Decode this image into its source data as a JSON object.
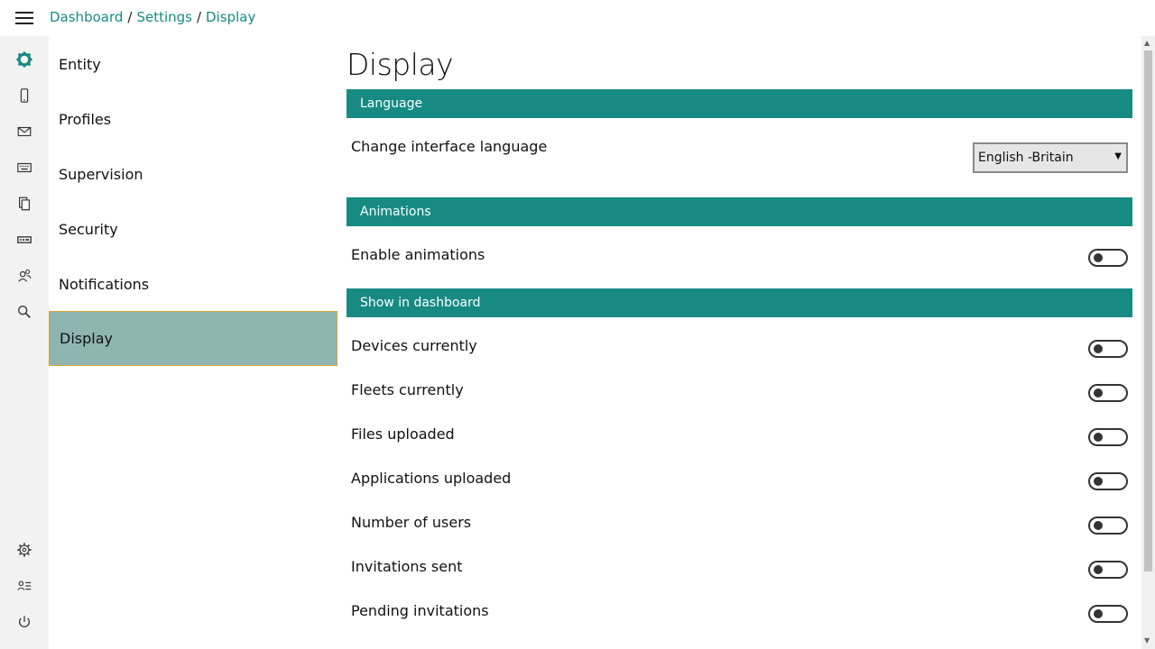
{
  "breadcrumb": {
    "level1": "Dashboard",
    "level2": "Settings",
    "level3": "Display",
    "separator": "/"
  },
  "rail": {
    "top_icons": [
      "logo-gear-icon",
      "phone-icon",
      "mail-icon",
      "keyboard-icon",
      "files-icon",
      "card-icon",
      "users-icon",
      "search-icon"
    ],
    "bottom_icons": [
      "settings-icon",
      "user-list-icon",
      "power-icon"
    ]
  },
  "submenu": {
    "items": [
      {
        "label": "Entity"
      },
      {
        "label": "Profiles"
      },
      {
        "label": "Supervision"
      },
      {
        "label": "Security"
      },
      {
        "label": "Notifications"
      },
      {
        "label": "Display",
        "active": true
      }
    ]
  },
  "main": {
    "title": "Display",
    "language": {
      "header": "Language",
      "label": "Change interface language",
      "selected": "English -Britain"
    },
    "animations": {
      "header": "Animations",
      "label": "Enable animations",
      "enabled": false
    },
    "dashboard": {
      "header": "Show in dashboard",
      "items": [
        {
          "label": "Devices currently",
          "enabled": false
        },
        {
          "label": "Fleets currently",
          "enabled": false
        },
        {
          "label": "Files uploaded",
          "enabled": false
        },
        {
          "label": "Applications uploaded",
          "enabled": false
        },
        {
          "label": "Number of users",
          "enabled": false
        },
        {
          "label": "Invitations sent",
          "enabled": false
        },
        {
          "label": "Pending invitations",
          "enabled": false
        }
      ]
    }
  },
  "colors": {
    "accent": "#178a84",
    "active_item": "#8fb5b1",
    "active_border": "#d9a33a"
  }
}
